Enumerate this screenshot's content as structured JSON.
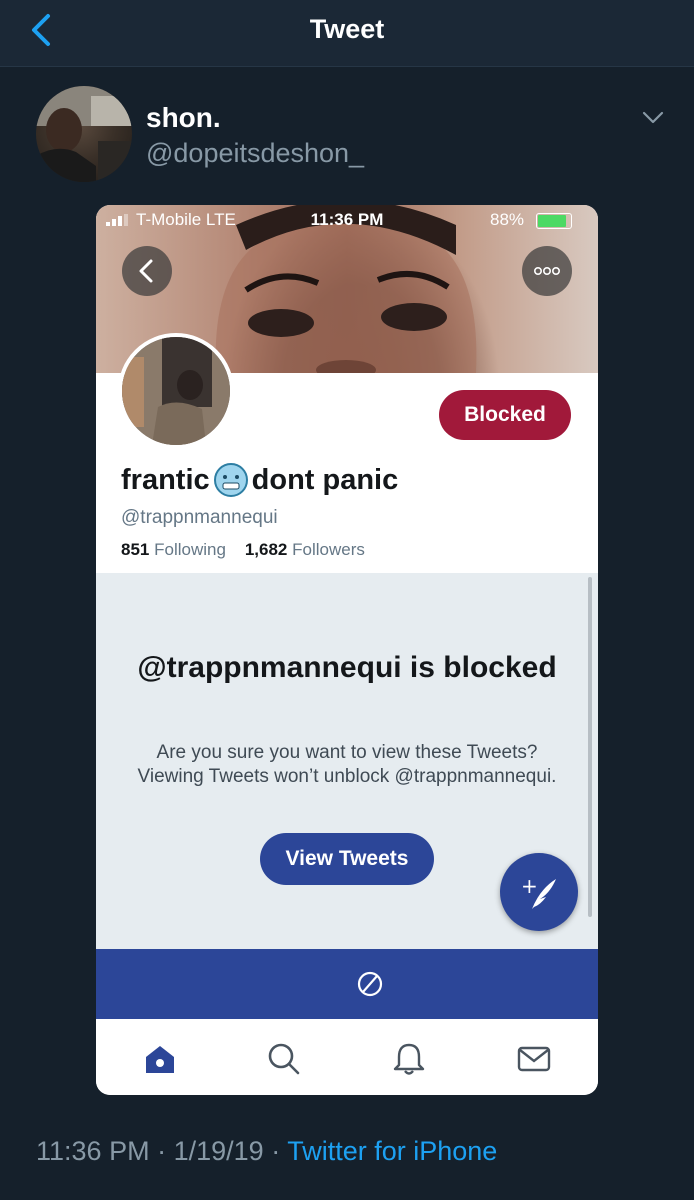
{
  "colors": {
    "app_background": "#15202b",
    "accent": "#1da1f2",
    "blocked_red": "#a1193a",
    "twitter_blue_dark": "#2c4698"
  },
  "nav": {
    "title": "Tweet",
    "back_icon": "chevron-left-icon"
  },
  "tweet": {
    "author_name": "shon.",
    "author_handle": "@dopeitsdeshon_",
    "menu_icon": "chevron-down-icon",
    "time": "11:36 PM",
    "date": "1/19/19",
    "separator": "·",
    "source": "Twitter for iPhone"
  },
  "screenshot": {
    "status_bar": {
      "carrier": "T-Mobile  LTE",
      "time": "11:36 PM",
      "battery": "88%",
      "battery_level": 0.88
    },
    "profile": {
      "name_part1": "frantic",
      "emoji": "cold-face-emoji",
      "name_part2": "dont panic",
      "handle": "@trappnmannequi",
      "following_count": "851",
      "following_label": "Following",
      "followers_count": "1,682",
      "followers_label": "Followers",
      "blocked_button": "Blocked"
    },
    "blocked_notice": {
      "title": "@trappnmannequi is blocked",
      "description": "Are you sure you want to view these Tweets? Viewing Tweets won’t unblock @trappnmannequi.",
      "button": "View Tweets"
    },
    "tabs": [
      "home-icon",
      "search-icon",
      "notifications-icon",
      "messages-icon"
    ]
  }
}
